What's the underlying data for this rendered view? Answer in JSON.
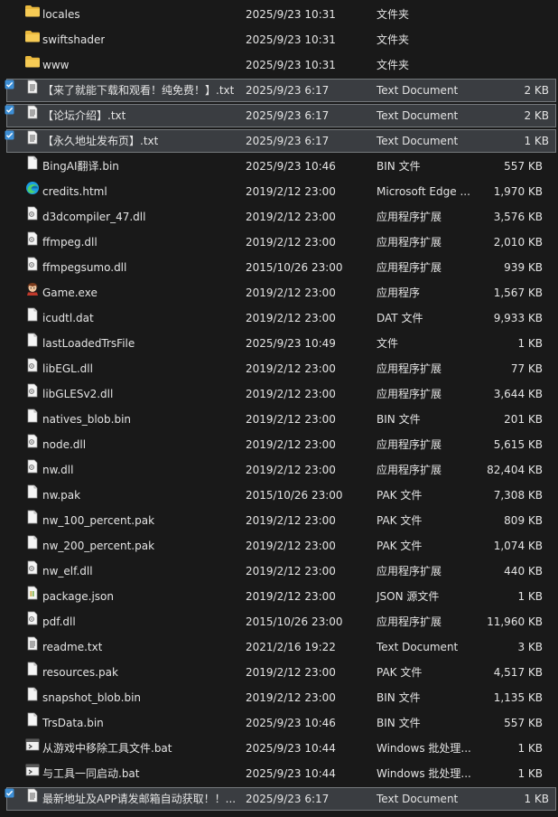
{
  "files": [
    {
      "name": "locales",
      "date": "2025/9/23 10:31",
      "type": "文件夹",
      "size": "",
      "icon": "folder-icon"
    },
    {
      "name": "swiftshader",
      "date": "2025/9/23 10:31",
      "type": "文件夹",
      "size": "",
      "icon": "folder-icon"
    },
    {
      "name": "www",
      "date": "2025/9/23 10:31",
      "type": "文件夹",
      "size": "",
      "icon": "folder-icon"
    },
    {
      "name": "【来了就能下载和观看！纯免费！】.txt",
      "date": "2025/9/23 6:17",
      "type": "Text Document",
      "size": "2 KB",
      "icon": "text-document-icon",
      "selected": true
    },
    {
      "name": "【论坛介绍】.txt",
      "date": "2025/9/23 6:17",
      "type": "Text Document",
      "size": "2 KB",
      "icon": "text-document-icon",
      "selected": true
    },
    {
      "name": "【永久地址发布页】.txt",
      "date": "2025/9/23 6:17",
      "type": "Text Document",
      "size": "1 KB",
      "icon": "text-document-icon",
      "selected": true
    },
    {
      "name": "BingAI翻译.bin",
      "date": "2025/9/23 10:46",
      "type": "BIN 文件",
      "size": "557 KB",
      "icon": "file-icon"
    },
    {
      "name": "credits.html",
      "date": "2019/2/12 23:00",
      "type": "Microsoft Edge ...",
      "size": "1,970 KB",
      "icon": "edge-icon"
    },
    {
      "name": "d3dcompiler_47.dll",
      "date": "2019/2/12 23:00",
      "type": "应用程序扩展",
      "size": "3,576 KB",
      "icon": "dll-icon"
    },
    {
      "name": "ffmpeg.dll",
      "date": "2019/2/12 23:00",
      "type": "应用程序扩展",
      "size": "2,010 KB",
      "icon": "dll-icon"
    },
    {
      "name": "ffmpegsumo.dll",
      "date": "2015/10/26 23:00",
      "type": "应用程序扩展",
      "size": "939 KB",
      "icon": "dll-icon"
    },
    {
      "name": "Game.exe",
      "date": "2019/2/12 23:00",
      "type": "应用程序",
      "size": "1,567 KB",
      "icon": "game-exe-icon"
    },
    {
      "name": "icudtl.dat",
      "date": "2019/2/12 23:00",
      "type": "DAT 文件",
      "size": "9,933 KB",
      "icon": "file-icon"
    },
    {
      "name": "lastLoadedTrsFile",
      "date": "2025/9/23 10:49",
      "type": "文件",
      "size": "1 KB",
      "icon": "file-icon"
    },
    {
      "name": "libEGL.dll",
      "date": "2019/2/12 23:00",
      "type": "应用程序扩展",
      "size": "77 KB",
      "icon": "dll-icon"
    },
    {
      "name": "libGLESv2.dll",
      "date": "2019/2/12 23:00",
      "type": "应用程序扩展",
      "size": "3,644 KB",
      "icon": "dll-icon"
    },
    {
      "name": "natives_blob.bin",
      "date": "2019/2/12 23:00",
      "type": "BIN 文件",
      "size": "201 KB",
      "icon": "file-icon"
    },
    {
      "name": "node.dll",
      "date": "2019/2/12 23:00",
      "type": "应用程序扩展",
      "size": "5,615 KB",
      "icon": "dll-icon"
    },
    {
      "name": "nw.dll",
      "date": "2019/2/12 23:00",
      "type": "应用程序扩展",
      "size": "82,404 KB",
      "icon": "dll-icon"
    },
    {
      "name": "nw.pak",
      "date": "2015/10/26 23:00",
      "type": "PAK 文件",
      "size": "7,308 KB",
      "icon": "file-icon"
    },
    {
      "name": "nw_100_percent.pak",
      "date": "2019/2/12 23:00",
      "type": "PAK 文件",
      "size": "809 KB",
      "icon": "file-icon"
    },
    {
      "name": "nw_200_percent.pak",
      "date": "2019/2/12 23:00",
      "type": "PAK 文件",
      "size": "1,074 KB",
      "icon": "file-icon"
    },
    {
      "name": "nw_elf.dll",
      "date": "2019/2/12 23:00",
      "type": "应用程序扩展",
      "size": "440 KB",
      "icon": "dll-icon"
    },
    {
      "name": "package.json",
      "date": "2019/2/12 23:00",
      "type": "JSON 源文件",
      "size": "1 KB",
      "icon": "json-icon"
    },
    {
      "name": "pdf.dll",
      "date": "2015/10/26 23:00",
      "type": "应用程序扩展",
      "size": "11,960 KB",
      "icon": "dll-icon"
    },
    {
      "name": "readme.txt",
      "date": "2021/2/16 19:22",
      "type": "Text Document",
      "size": "3 KB",
      "icon": "text-document-icon"
    },
    {
      "name": "resources.pak",
      "date": "2019/2/12 23:00",
      "type": "PAK 文件",
      "size": "4,517 KB",
      "icon": "file-icon"
    },
    {
      "name": "snapshot_blob.bin",
      "date": "2019/2/12 23:00",
      "type": "BIN 文件",
      "size": "1,135 KB",
      "icon": "file-icon"
    },
    {
      "name": "TrsData.bin",
      "date": "2025/9/23 10:46",
      "type": "BIN 文件",
      "size": "557 KB",
      "icon": "file-icon"
    },
    {
      "name": "从游戏中移除工具文件.bat",
      "date": "2025/9/23 10:44",
      "type": "Windows 批处理...",
      "size": "1 KB",
      "icon": "batch-icon"
    },
    {
      "name": "与工具一同启动.bat",
      "date": "2025/9/23 10:44",
      "type": "Windows 批处理...",
      "size": "1 KB",
      "icon": "batch-icon"
    },
    {
      "name": "最新地址及APP请发邮箱自动获取！！...",
      "date": "2025/9/23 6:17",
      "type": "Text Document",
      "size": "1 KB",
      "icon": "text-document-icon",
      "selected": true
    }
  ],
  "colors": {
    "folder": "#e9b83d",
    "selection": "#3a3d41",
    "check": "#3d8fd6"
  }
}
